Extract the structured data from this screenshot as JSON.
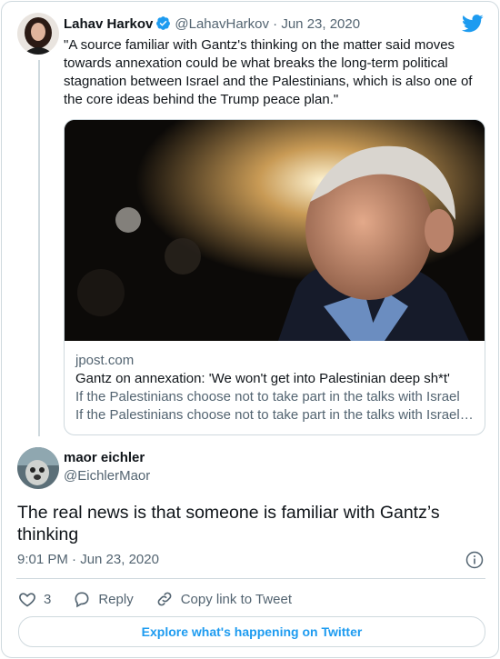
{
  "quoted": {
    "name": "Lahav Harkov",
    "handle": "@LahavHarkov",
    "separator": "·",
    "date": "Jun 23, 2020",
    "text": "\"A source familiar with Gantz's thinking on the matter said moves towards annexation could be what breaks the long-term political stagnation between Israel and the Palestinians, which is also one of the core ideas behind the Trump peace plan.\"",
    "link_card": {
      "domain": "jpost.com",
      "title": "Gantz on annexation: 'We won't get into Palestinian deep sh*t'",
      "description": "If the Palestinians choose not to take part in the talks with Israel about the annexation, “then we will have to move forward without…"
    }
  },
  "reply": {
    "name": "maor eichler",
    "handle": "@EichlerMaor",
    "text": "The real news is that someone is familiar with Gantz’s thinking",
    "timestamp": "9:01 PM · Jun 23, 2020"
  },
  "actions": {
    "like_count": "3",
    "reply_label": "Reply",
    "copy_label": "Copy link to Tweet"
  },
  "explore_label": "Explore what's happening on Twitter",
  "colors": {
    "accent": "#1d9bf0",
    "muted": "#536471",
    "border": "#cfd9de"
  }
}
